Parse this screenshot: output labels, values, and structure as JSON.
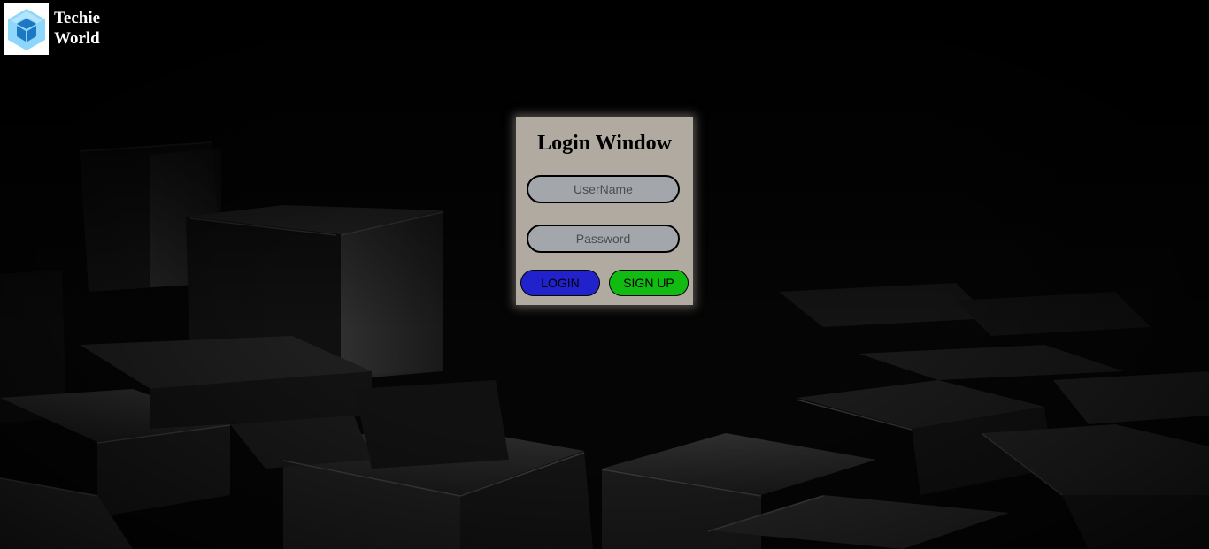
{
  "brand": {
    "name_line1": "Techie",
    "name_line2": "World",
    "logo_icon": "cube-icon"
  },
  "login": {
    "title": "Login Window",
    "username_placeholder": "UserName",
    "password_placeholder": "Password",
    "login_label": "LOGIN",
    "signup_label": "SIGN UP"
  },
  "colors": {
    "login_button": "#2222cc",
    "signup_button": "#11bb11",
    "panel": "#c8c1b7",
    "field": "#a3a7ab"
  }
}
